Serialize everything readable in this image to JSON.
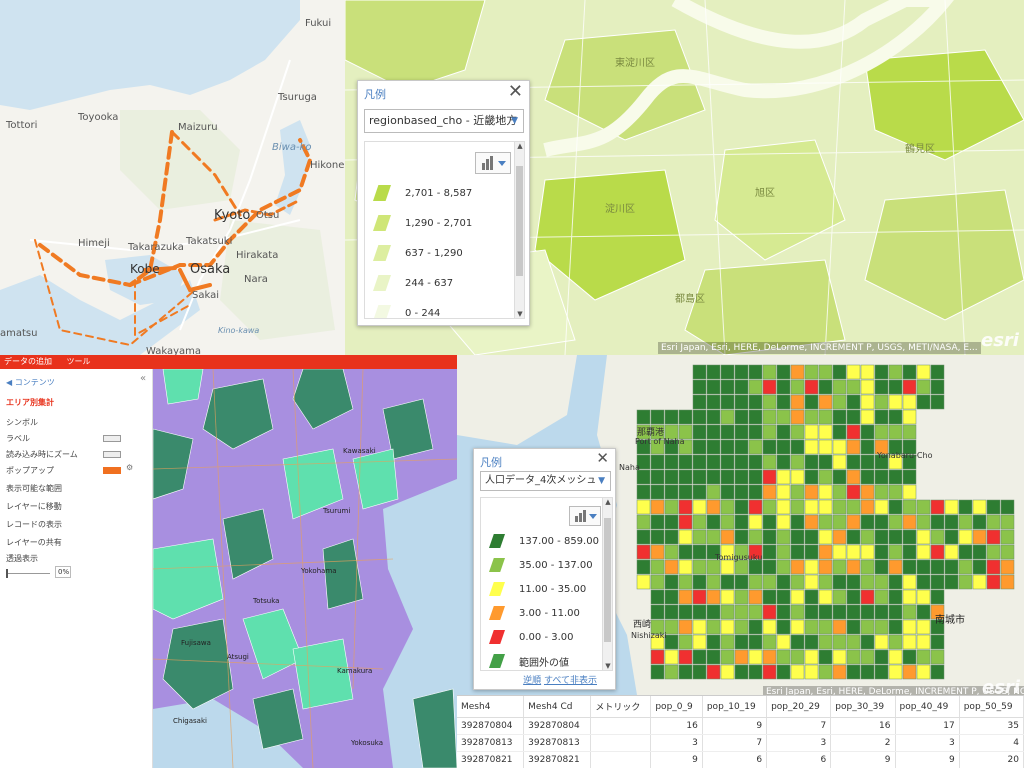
{
  "top_left_map": {
    "labels": [
      "Fukui",
      "Tsuruga",
      "Toyooka",
      "Tottori",
      "Maizuru",
      "Biwa-ko",
      "Hikone",
      "Kyoto",
      "Otsu",
      "Himeji",
      "Takarazuka",
      "Takatsuki",
      "Kobe",
      "Osaka",
      "Hirakata",
      "Nara",
      "Sakai",
      "amatsu",
      "Wakayama",
      "Kino-kawa"
    ]
  },
  "legend_top": {
    "title": "凡例",
    "layer_select": "regionbased_cho - 近畿地方",
    "classes": [
      {
        "label": "2,701 - 8,587",
        "color": "#b9db4a"
      },
      {
        "label": "1,290 - 2,701",
        "color": "#cfe677"
      },
      {
        "label": "637 - 1,290",
        "color": "#ddeea0"
      },
      {
        "label": "244 - 637",
        "color": "#e9f4c6"
      },
      {
        "label": "0 - 244",
        "color": "#f3f9e2"
      }
    ]
  },
  "top_right_map": {
    "labels": [
      "東淀川区",
      "淀川区",
      "旭区",
      "都島区",
      "鶴見区"
    ],
    "attribution": "Esri Japan, Esri, HERE, DeLorme, INCREMENT P, USGS, METI/NASA, E...",
    "logo": "esri"
  },
  "app_panel": {
    "menu": [
      "データの追加",
      "ツール"
    ],
    "back": "◀ コンテンツ",
    "section": "エリア別集計",
    "items": [
      "シンボル",
      "ラベル",
      "読み込み時にズーム",
      "ポップアップ",
      "表示可能な範囲",
      "レイヤーに移動",
      "レコードの表示",
      "レイヤーの共有",
      "透過表示"
    ],
    "transparency_value": "0%"
  },
  "bottom_left_map": {
    "labels": [
      "Tsurumi",
      "Yokohama",
      "Kawasaki",
      "Totsuka",
      "Atsugi",
      "Fujisawa",
      "Kamakura",
      "Yokosuka",
      "Chigasaki"
    ]
  },
  "legend_bottom": {
    "title": "凡例",
    "layer_select": "人口データ_4次メッシュ",
    "classes": [
      {
        "label": "137.00 - 859.00",
        "color": "#2e7d32"
      },
      {
        "label": "35.00 - 137.00",
        "color": "#8bc34a"
      },
      {
        "label": "11.00 - 35.00",
        "color": "#ffff4d"
      },
      {
        "label": "3.00 - 11.00",
        "color": "#ff9a2e"
      },
      {
        "label": "0.00 - 3.00",
        "color": "#f03030"
      },
      {
        "label": "範囲外の値",
        "color": "#43a047"
      }
    ],
    "link_reverse": "逆順",
    "link_hide_all": "すべて非表示"
  },
  "bottom_right_map": {
    "labels": [
      "那覇港",
      "Port of Naha",
      "Naha",
      "Tomigusuku",
      "Yonabaru-Cho",
      "西崎",
      "Nishizaki",
      "南城市"
    ],
    "attribution": "Esri Japan, Esri, HERE, DeLorme, INCREMENT P, USGS, NGA",
    "logo": "esri"
  },
  "attribute_table": {
    "columns": [
      "Mesh4",
      "Mesh4 Cd",
      "メトリック",
      "pop_0_9",
      "pop_10_19",
      "pop_20_29",
      "pop_30_39",
      "pop_40_49",
      "pop_50_59"
    ],
    "rows": [
      [
        "392870804",
        "392870804",
        "",
        "16",
        "9",
        "7",
        "16",
        "17",
        "35"
      ],
      [
        "392870813",
        "392870813",
        "",
        "3",
        "7",
        "3",
        "2",
        "3",
        "4"
      ],
      [
        "392870821",
        "392870821",
        "",
        "9",
        "6",
        "6",
        "9",
        "9",
        "20"
      ]
    ]
  }
}
